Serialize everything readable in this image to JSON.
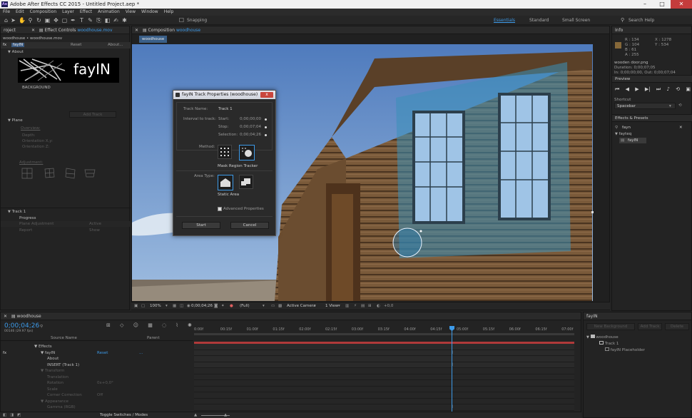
{
  "window": {
    "title": "Adobe After Effects CC 2015 - Untitled Project.aep *"
  },
  "menu": [
    "File",
    "Edit",
    "Composition",
    "Layer",
    "Effect",
    "Animation",
    "View",
    "Window",
    "Help"
  ],
  "toolbar": {
    "snapping": "Snapping",
    "workspaces": [
      "Essentials",
      "Standard",
      "Small Screen"
    ],
    "search": "Search Help"
  },
  "effect_controls": {
    "tab_left": "roject",
    "tab": "Effect Controls",
    "tab_file": "woodhouse.mov",
    "breadcrumb": "woodhouse • woodhouse.mov",
    "effect_name": "fayIN",
    "reset": "Reset",
    "about_link": "About...",
    "about": "About",
    "logo_text": "fayIN",
    "background_label": "BACKGROUND",
    "add_track": "Add Track",
    "plane": "Plane",
    "plane_items": [
      "Overview:",
      "Depth:",
      "Orientation X,y:",
      "Orientation Z:"
    ],
    "adjustment": "Adjustment:",
    "track1": "Track 1",
    "progress": "Progress",
    "plane_adjustment": "Plane Adjustment",
    "active": "Active",
    "report": "Report",
    "show": "Show"
  },
  "composition": {
    "tab": "Composition",
    "tab_name": "woodhouse",
    "subtab": "woodhouse",
    "footer": {
      "zoom": "100%",
      "timecode": "0;00;04;26",
      "resolution": "(Full)",
      "camera": "Active Camera",
      "view": "1 View",
      "offset": "+0,0"
    }
  },
  "dialog": {
    "title": "fayIN Track Properties (woodhouse)",
    "close": "x",
    "track_name_label": "Track Name:",
    "track_name": "Track 1",
    "interval_label": "Interval to track:",
    "start_label": "Start:",
    "start_value": "0;00;00;00",
    "stop_label": "Stop:",
    "stop_value": "0;00;07;04",
    "selection_label": "Selection:",
    "selection_value": "0;00;04;26",
    "method_label": "Method:",
    "method_caption": "Mask Region Tracker",
    "area_label": "Area Type:",
    "area_caption": "Static Area",
    "advanced": "Advanced Properties",
    "start_btn": "Start",
    "cancel_btn": "Cancel"
  },
  "info": {
    "title": "Info",
    "r": "R : 134",
    "g": "G : 104",
    "b": "B : 61",
    "a": "A : 255",
    "x": "X : 1278",
    "y": "Y : 534",
    "file": "wooden door.png",
    "duration": "Duration: 0;00;07;05",
    "in": "In: 0;00;00;00, Out: 0;00;07;04",
    "swatch": "#866839"
  },
  "preview": {
    "title": "Preview",
    "shortcut_label": "Shortcut",
    "shortcut": "Spacebar"
  },
  "effects_presets": {
    "title": "Effects & Presets",
    "search": "fayn",
    "folder": "fayteq",
    "item": "fayIN"
  },
  "timeline": {
    "tab": "woodhouse",
    "timecode": "0;00;04;26",
    "fps": "00146 (29.97 fps)",
    "col_source": "Source Name",
    "col_parent": "Parent",
    "rows": [
      {
        "label": "Effects",
        "indent": 0
      },
      {
        "label": "fayIN",
        "indent": 1,
        "reset": "Reset",
        "extra": "..."
      },
      {
        "label": "About",
        "indent": 2
      },
      {
        "label": "INSERT (Track 1)",
        "indent": 2
      },
      {
        "label": "Transform",
        "indent": 1,
        "dim": true
      },
      {
        "label": "Translation",
        "indent": 2,
        "dim": true
      },
      {
        "label": "Rotation",
        "indent": 2,
        "dim": true,
        "value": "0x+0,0°"
      },
      {
        "label": "Scale",
        "indent": 2,
        "dim": true
      },
      {
        "label": "Corner Correction",
        "indent": 2,
        "dim": true,
        "value": "Off"
      },
      {
        "label": "Appearance",
        "indent": 1,
        "dim": true
      },
      {
        "label": "Gamma (RGB)",
        "indent": 2,
        "dim": true
      }
    ],
    "ticks": [
      "0:00f",
      "00:15f",
      "01:00f",
      "01:15f",
      "02:00f",
      "02:15f",
      "03:00f",
      "03:15f",
      "04:00f",
      "04:15f",
      "05:00f",
      "05:15f",
      "06:00f",
      "06:15f",
      "07:00f"
    ],
    "toggle": "Toggle Switches / Modes"
  },
  "fayin_panel": {
    "title": "fayIN",
    "new_background": "New Background",
    "add_track": "Add Track",
    "delete": "Delete",
    "tree": [
      "woodhouse",
      "Track 1",
      "fayIN Placeholder"
    ]
  }
}
